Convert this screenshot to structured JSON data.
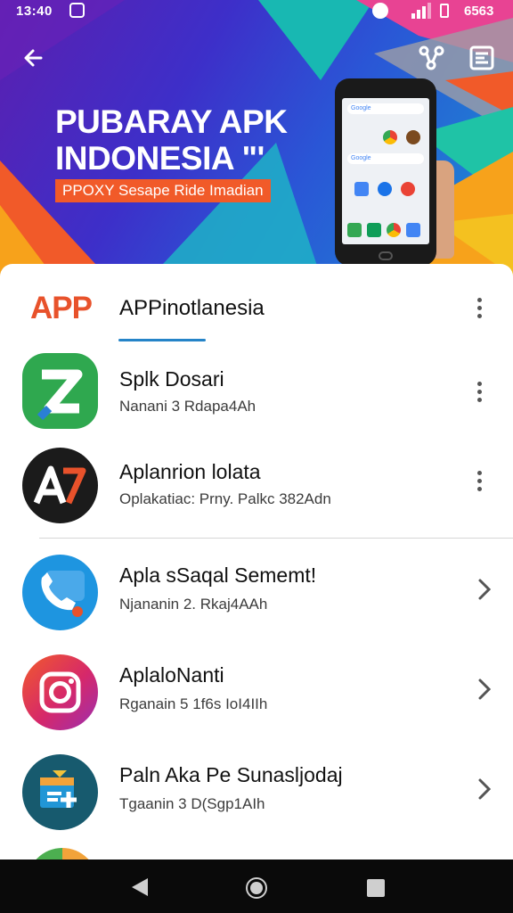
{
  "status_bar": {
    "time": "13:40",
    "battery_text": "6563"
  },
  "hero": {
    "title": "PUBARAY APK INDONESIA \"'",
    "tagline": "PPOXY Sesape Ride Imadian",
    "phone_search_label": "Google",
    "phone_search_label_2": "Google"
  },
  "header": {
    "logo_text": "APP",
    "title": "APPinotlanesia"
  },
  "apps": [
    {
      "title": "Splk Dosari",
      "subtitle": "Nanani 3 Rdapa4Ah",
      "icon": "green-z-icon",
      "action": "more"
    },
    {
      "title": "Aplanrion lolata",
      "subtitle": "Oplakatiac: Prny. Palkc 382Adn",
      "icon": "a7-logo-icon",
      "action": "more"
    },
    {
      "title": "Apla sSaqal Sememt!",
      "subtitle": "Njananin 2. Rkaj4AAh",
      "icon": "phone-call-icon",
      "action": "open"
    },
    {
      "title": "AplaloNanti",
      "subtitle": "Rganain 5 1f6s IoI4IIh",
      "icon": "instagram-camera-icon",
      "action": "open"
    },
    {
      "title": "Paln Aka Pe Sunasljodaj",
      "subtitle": "Tgaanin 3 D(Sgp1AIh",
      "icon": "calendar-plus-icon",
      "action": "open"
    }
  ],
  "colors": {
    "accent": "#2584c8",
    "logo": "#e8522b",
    "tag": "#f15a29",
    "navbar": "#0a0a0a"
  }
}
